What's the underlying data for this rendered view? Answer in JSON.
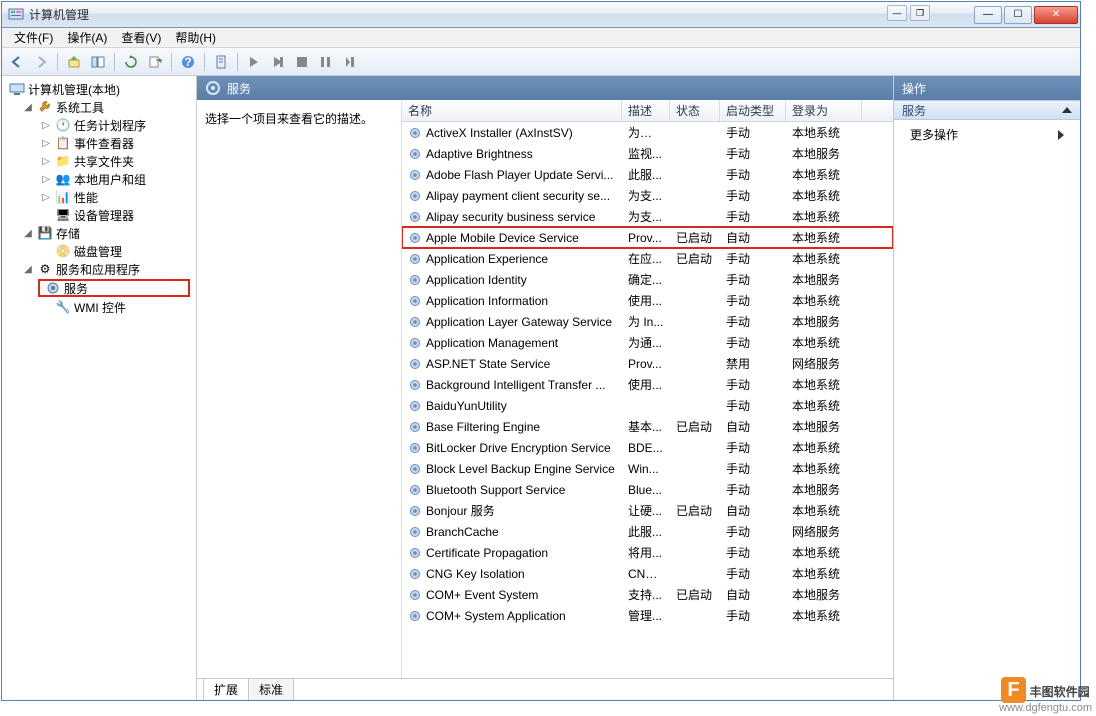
{
  "titlebar": {
    "title": "计算机管理"
  },
  "menu": {
    "file": "文件(F)",
    "action": "操作(A)",
    "view": "查看(V)",
    "help": "帮助(H)"
  },
  "tree": {
    "root": "计算机管理(本地)",
    "system_tools": "系统工具",
    "task_scheduler": "任务计划程序",
    "event_viewer": "事件查看器",
    "shared_folders": "共享文件夹",
    "local_users": "本地用户和组",
    "performance": "性能",
    "device_manager": "设备管理器",
    "storage": "存储",
    "disk_mgmt": "磁盘管理",
    "services_apps": "服务和应用程序",
    "services": "服务",
    "wmi": "WMI 控件"
  },
  "center": {
    "header": "服务",
    "desc_prompt": "选择一个项目来查看它的描述。",
    "columns": {
      "name": "名称",
      "desc": "描述",
      "state": "状态",
      "stype": "启动类型",
      "logon": "登录为"
    },
    "tabs": {
      "extended": "扩展",
      "standard": "标准"
    }
  },
  "right": {
    "header": "操作",
    "services": "服务",
    "more": "更多操作"
  },
  "services": [
    {
      "name": "ActiveX Installer (AxInstSV)",
      "desc": "为从 ...",
      "state": "",
      "stype": "手动",
      "logon": "本地系统",
      "hl": false
    },
    {
      "name": "Adaptive Brightness",
      "desc": "监视...",
      "state": "",
      "stype": "手动",
      "logon": "本地服务",
      "hl": false
    },
    {
      "name": "Adobe Flash Player Update Servi...",
      "desc": "此服...",
      "state": "",
      "stype": "手动",
      "logon": "本地系统",
      "hl": false
    },
    {
      "name": "Alipay payment client security se...",
      "desc": "为支...",
      "state": "",
      "stype": "手动",
      "logon": "本地系统",
      "hl": false
    },
    {
      "name": "Alipay security business service",
      "desc": "为支...",
      "state": "",
      "stype": "手动",
      "logon": "本地系统",
      "hl": false
    },
    {
      "name": "Apple Mobile Device Service",
      "desc": "Prov...",
      "state": "已启动",
      "stype": "自动",
      "logon": "本地系统",
      "hl": true
    },
    {
      "name": "Application Experience",
      "desc": "在应...",
      "state": "已启动",
      "stype": "手动",
      "logon": "本地系统",
      "hl": false
    },
    {
      "name": "Application Identity",
      "desc": "确定...",
      "state": "",
      "stype": "手动",
      "logon": "本地服务",
      "hl": false
    },
    {
      "name": "Application Information",
      "desc": "使用...",
      "state": "",
      "stype": "手动",
      "logon": "本地系统",
      "hl": false
    },
    {
      "name": "Application Layer Gateway Service",
      "desc": "为 In...",
      "state": "",
      "stype": "手动",
      "logon": "本地服务",
      "hl": false
    },
    {
      "name": "Application Management",
      "desc": "为通...",
      "state": "",
      "stype": "手动",
      "logon": "本地系统",
      "hl": false
    },
    {
      "name": "ASP.NET State Service",
      "desc": "Prov...",
      "state": "",
      "stype": "禁用",
      "logon": "网络服务",
      "hl": false
    },
    {
      "name": "Background Intelligent Transfer ...",
      "desc": "使用...",
      "state": "",
      "stype": "手动",
      "logon": "本地系统",
      "hl": false
    },
    {
      "name": "BaiduYunUtility",
      "desc": "",
      "state": "",
      "stype": "手动",
      "logon": "本地系统",
      "hl": false
    },
    {
      "name": "Base Filtering Engine",
      "desc": "基本...",
      "state": "已启动",
      "stype": "自动",
      "logon": "本地服务",
      "hl": false
    },
    {
      "name": "BitLocker Drive Encryption Service",
      "desc": "BDE...",
      "state": "",
      "stype": "手动",
      "logon": "本地系统",
      "hl": false
    },
    {
      "name": "Block Level Backup Engine Service",
      "desc": "Win...",
      "state": "",
      "stype": "手动",
      "logon": "本地系统",
      "hl": false
    },
    {
      "name": "Bluetooth Support Service",
      "desc": "Blue...",
      "state": "",
      "stype": "手动",
      "logon": "本地服务",
      "hl": false
    },
    {
      "name": "Bonjour 服务",
      "desc": "让硬...",
      "state": "已启动",
      "stype": "自动",
      "logon": "本地系统",
      "hl": false
    },
    {
      "name": "BranchCache",
      "desc": "此服...",
      "state": "",
      "stype": "手动",
      "logon": "网络服务",
      "hl": false
    },
    {
      "name": "Certificate Propagation",
      "desc": "将用...",
      "state": "",
      "stype": "手动",
      "logon": "本地系统",
      "hl": false
    },
    {
      "name": "CNG Key Isolation",
      "desc": "CNG...",
      "state": "",
      "stype": "手动",
      "logon": "本地系统",
      "hl": false
    },
    {
      "name": "COM+ Event System",
      "desc": "支持...",
      "state": "已启动",
      "stype": "自动",
      "logon": "本地服务",
      "hl": false
    },
    {
      "name": "COM+ System Application",
      "desc": "管理...",
      "state": "",
      "stype": "手动",
      "logon": "本地系统",
      "hl": false
    }
  ],
  "brand": {
    "name": "丰图软件园",
    "url": "www.dgfengtu.com"
  }
}
